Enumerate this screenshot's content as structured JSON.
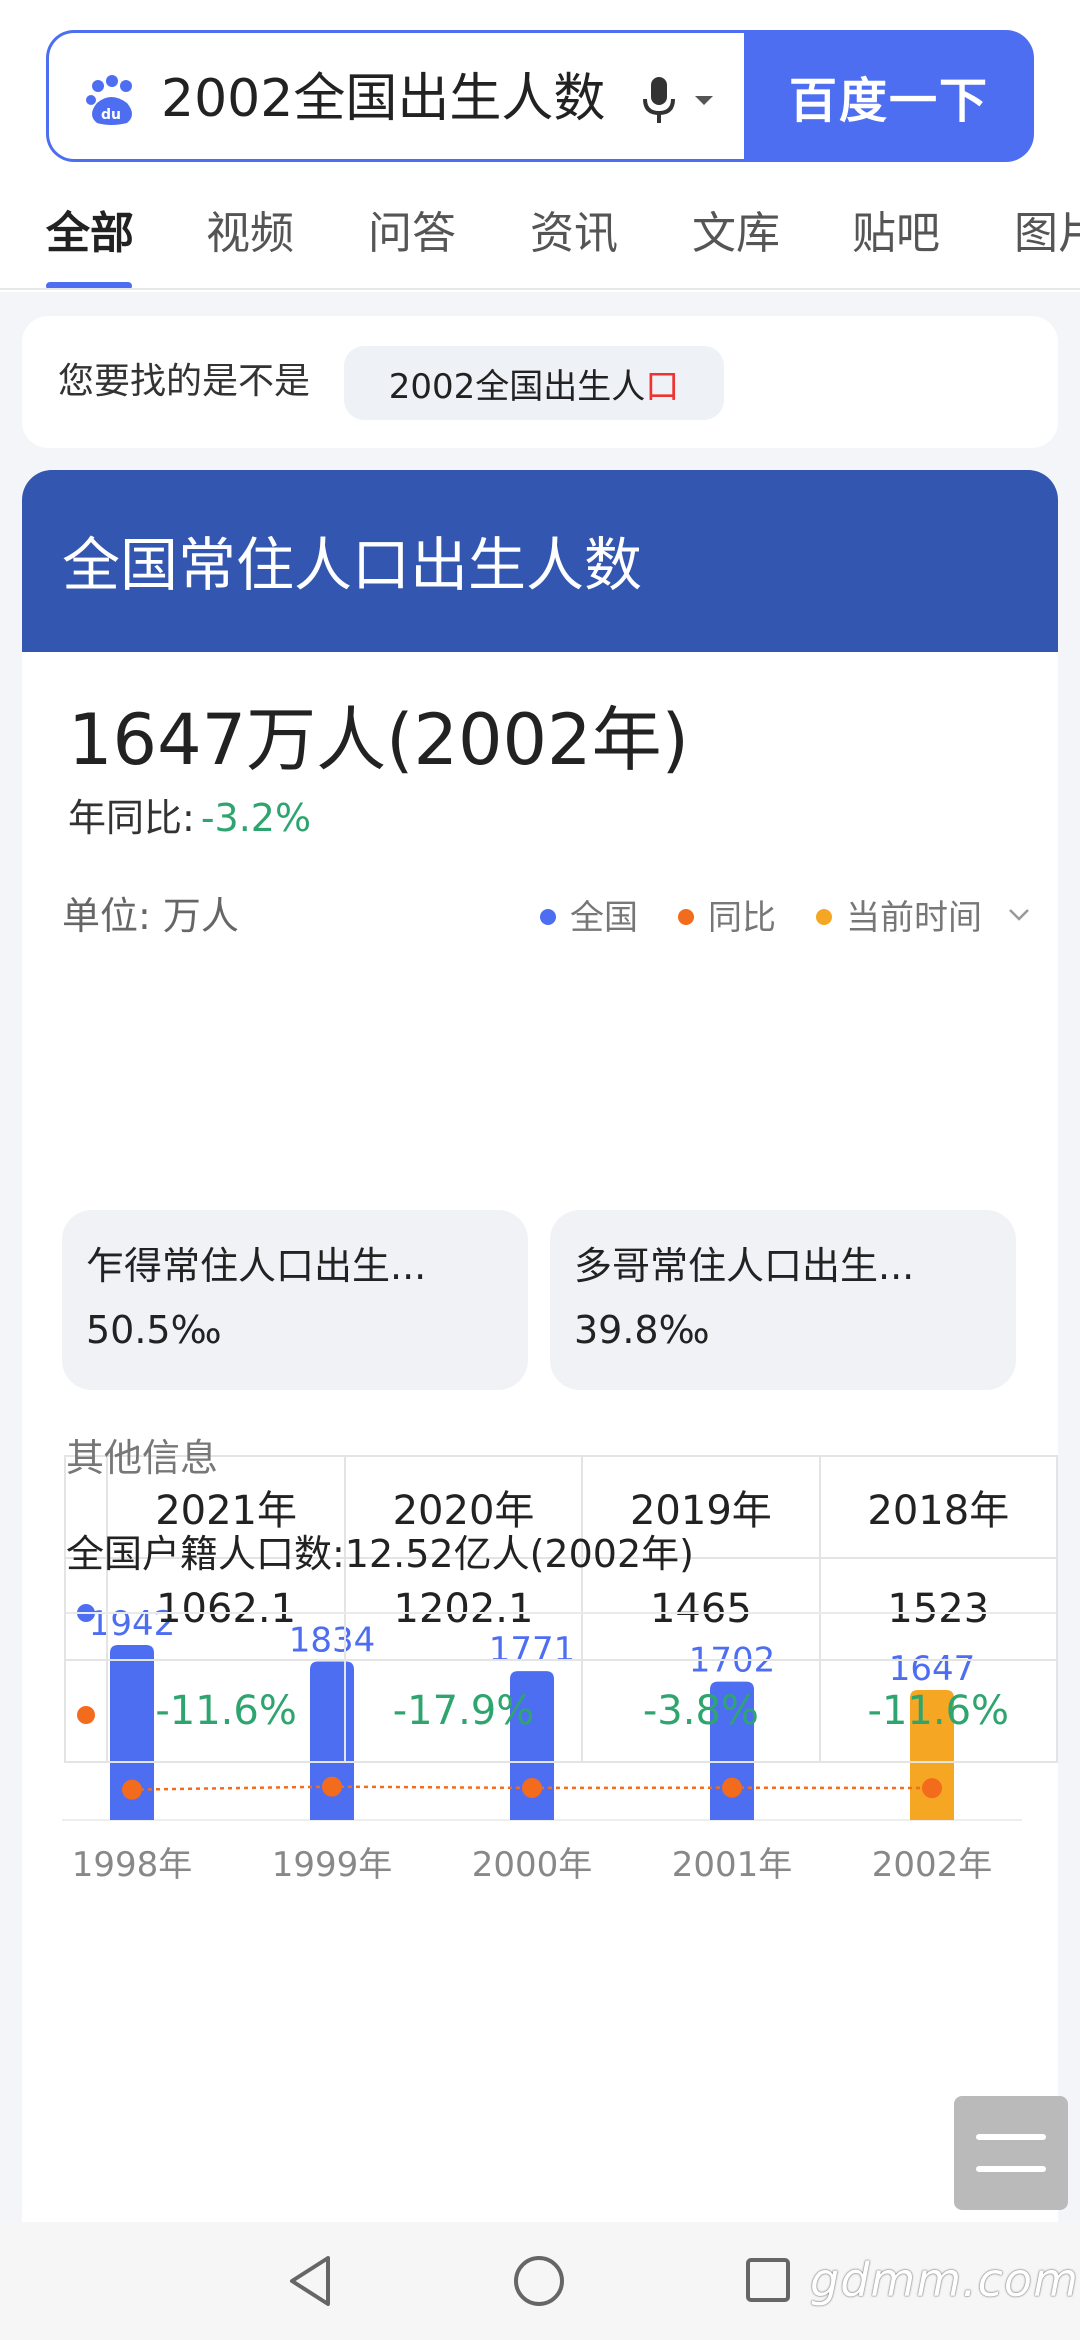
{
  "search": {
    "query": "2002全国出生人数",
    "button_label": "百度一下"
  },
  "tabs": [
    "全部",
    "视频",
    "问答",
    "资讯",
    "文库",
    "贴吧",
    "图片"
  ],
  "suggestion": {
    "label": "您要找的是不是",
    "chip_main": "2002全国出生人",
    "chip_highlight": "口"
  },
  "main": {
    "title": "全国常住人口出生人数",
    "big_value": "1647万人(2002年)",
    "yoy_label": "年同比:",
    "yoy_value": "-3.2%",
    "unit": "单位: 万人",
    "legend": [
      {
        "label": "全国",
        "color": "#4e6ef2"
      },
      {
        "label": "同比",
        "color": "#f36b1c"
      },
      {
        "label": "当前时间",
        "color": "#f5a623"
      }
    ]
  },
  "chart_data": {
    "type": "bar",
    "categories": [
      "1998年",
      "1999年",
      "2000年",
      "2001年",
      "2002年"
    ],
    "series": [
      {
        "name": "全国",
        "values": [
          1942,
          1834,
          1771,
          1702,
          1647
        ]
      }
    ],
    "yoy_line": [
      -0.6,
      -5.6,
      -3.4,
      -3.9,
      -3.2
    ],
    "highlight_index": 4,
    "colors": {
      "bar": "#4e6ef2",
      "current": "#f5a623",
      "line": "#f36b1c"
    },
    "grid": false,
    "legend_position": "top-right"
  },
  "table": {
    "headers": [
      "2021年",
      "2020年",
      "2019年",
      "2018年"
    ],
    "values": [
      "1062.1",
      "1202.1",
      "1465",
      "1523"
    ],
    "yoy": [
      "-11.6%",
      "-17.9%",
      "-3.8%",
      "-11.6%"
    ],
    "row_colors": [
      "#4e6ef2",
      "#f36b1c"
    ]
  },
  "stats": [
    {
      "title": "乍得常住人口出生...",
      "value": "50.5‰"
    },
    {
      "title": "多哥常住人口出生...",
      "value": "39.8‰"
    }
  ],
  "other": {
    "label": "其他信息",
    "info": "全国户籍人口数:12.52亿人(2002年)"
  },
  "watermark": "gdmm.com"
}
